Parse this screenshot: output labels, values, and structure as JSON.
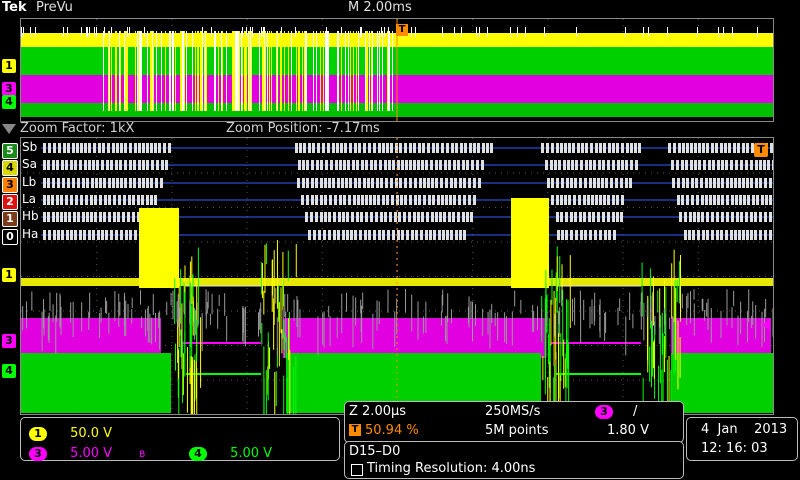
{
  "header": {
    "brand": "Tek",
    "mode": "PreVu",
    "timebase": "M 2.00ms"
  },
  "zoom": {
    "factor": "Zoom Factor: 1kX",
    "position": "Zoom Position: -7.17ms"
  },
  "digital_labels": [
    "Sb",
    "Sa",
    "Lb",
    "La",
    "Hb",
    "Ha"
  ],
  "channel_markers": [
    "5",
    "4",
    "3",
    "2",
    "1",
    "0"
  ],
  "analog_markers": [
    "1",
    "3",
    "4"
  ],
  "trigger_marker": "T",
  "channels_panel": {
    "ch1": {
      "num": "1",
      "scale": "50.0 V",
      "color": "#ffff00"
    },
    "ch3": {
      "num": "3",
      "scale": "5.00 V",
      "color": "#ff00ff",
      "bw": "B"
    },
    "ch4": {
      "num": "4",
      "scale": "5.00 V",
      "color": "#00ff00"
    }
  },
  "acq_panel": {
    "zoom_time": "Z 2.00µs",
    "sample_rate": "250MS/s",
    "trig_channel": "3",
    "trig_slope": "/",
    "trig_pos": "50.94 %",
    "points": "5M points",
    "trig_level": "1.80 V"
  },
  "digital_panel": {
    "group": "D15–D0",
    "resolution": "Timing Resolution: 4.00ns"
  },
  "datetime": {
    "date": "4  Jan    2013",
    "time": "12: 16: 03"
  }
}
